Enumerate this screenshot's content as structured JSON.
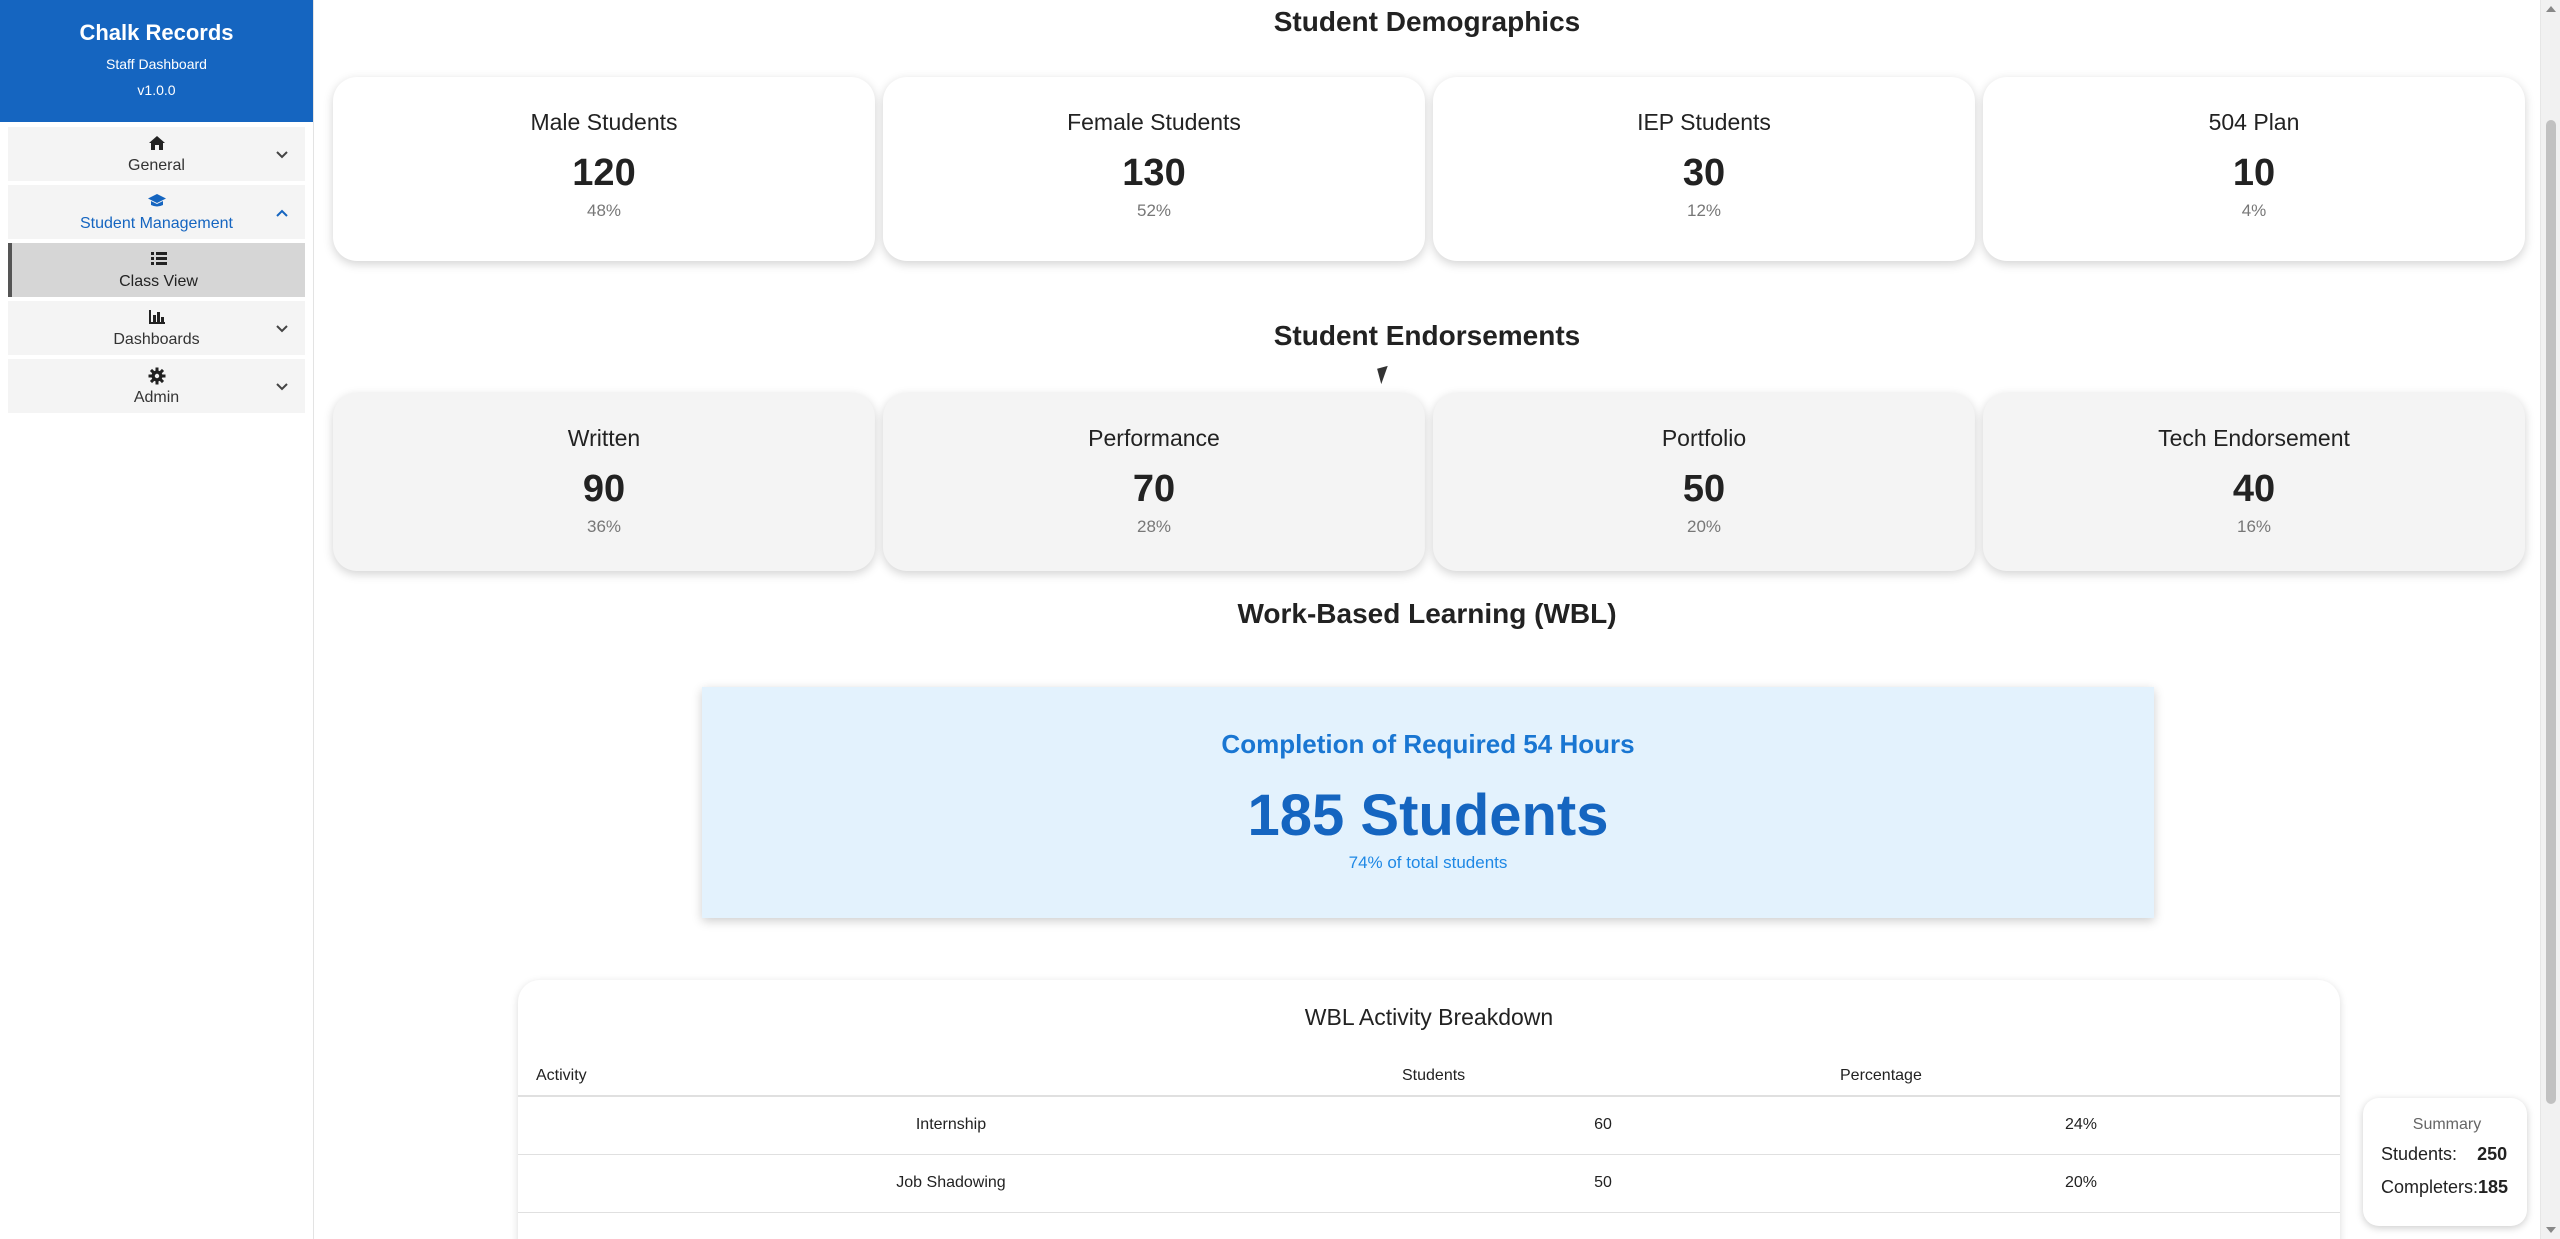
{
  "app": {
    "title": "Chalk Records",
    "subtitle": "Staff Dashboard",
    "version": "v1.0.0"
  },
  "sidebar": {
    "items": [
      {
        "label": "General",
        "icon": "home-icon",
        "expanded": false
      },
      {
        "label": "Student Management",
        "icon": "graduation-cap-icon",
        "expanded": true
      },
      {
        "label": "Class View",
        "icon": "list-icon",
        "selected": true
      },
      {
        "label": "Dashboards",
        "icon": "bar-chart-icon",
        "expanded": false
      },
      {
        "label": "Admin",
        "icon": "gear-icon",
        "expanded": false
      }
    ]
  },
  "demographics": {
    "title": "Student Demographics",
    "cards": [
      {
        "label": "Male Students",
        "value": "120",
        "pct": "48%"
      },
      {
        "label": "Female Students",
        "value": "130",
        "pct": "52%"
      },
      {
        "label": "IEP Students",
        "value": "30",
        "pct": "12%"
      },
      {
        "label": "504 Plan",
        "value": "10",
        "pct": "4%"
      }
    ]
  },
  "endorsements": {
    "title": "Student Endorsements",
    "cards": [
      {
        "label": "Written",
        "value": "90",
        "pct": "36%"
      },
      {
        "label": "Performance",
        "value": "70",
        "pct": "28%"
      },
      {
        "label": "Portfolio",
        "value": "50",
        "pct": "20%"
      },
      {
        "label": "Tech Endorsement",
        "value": "40",
        "pct": "16%"
      }
    ]
  },
  "wbl": {
    "title": "Work-Based Learning (WBL)",
    "completion_title": "Completion of Required 54 Hours",
    "completion_value": "185 Students",
    "completion_sub": "74% of total students",
    "breakdown": {
      "title": "WBL Activity Breakdown",
      "headers": [
        "Activity",
        "Students",
        "Percentage"
      ],
      "rows": [
        [
          "Internship",
          "60",
          "24%"
        ],
        [
          "Job Shadowing",
          "50",
          "20%"
        ]
      ]
    }
  },
  "summary": {
    "title": "Summary",
    "students_label": "Students:",
    "students_value": "250",
    "completers_label": "Completers:",
    "completers_value": "185"
  },
  "colors": {
    "brand": "#1565c0",
    "accent": "#1976d2",
    "wbl_bg": "#e3f2fd"
  }
}
